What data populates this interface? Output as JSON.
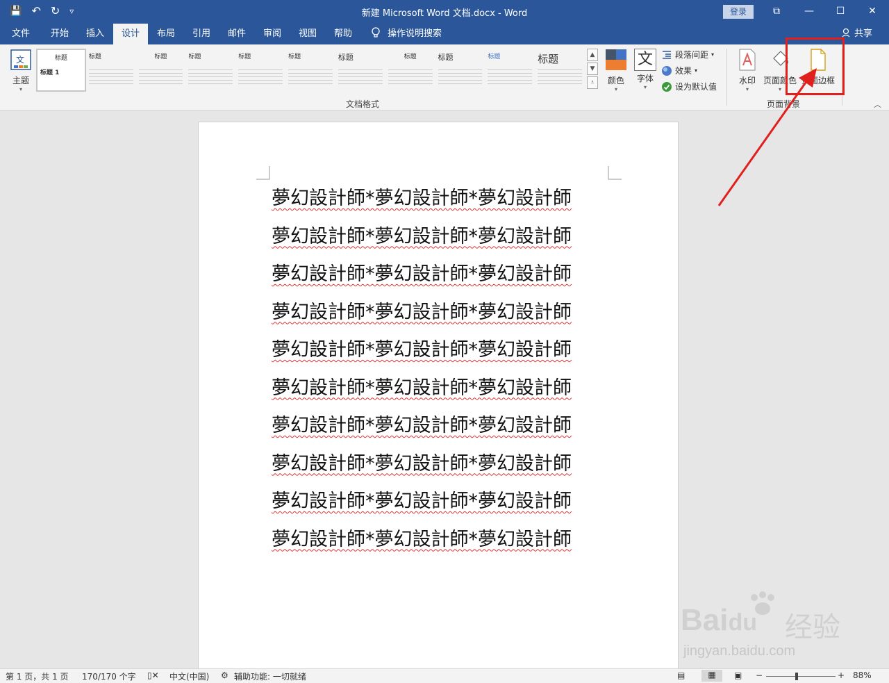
{
  "window": {
    "title": "新建 Microsoft Word 文档.docx  -  Word",
    "login_label": "登录",
    "controls": {
      "ribbon_display": "⧉",
      "minimize": "—",
      "maximize": "☐",
      "close": "✕"
    }
  },
  "qat": {
    "save": "💾",
    "undo": "↶",
    "redo": "↻",
    "more": "▿"
  },
  "tabs": [
    {
      "label": "文件"
    },
    {
      "label": "开始"
    },
    {
      "label": "插入"
    },
    {
      "label": "设计",
      "active": true
    },
    {
      "label": "布局"
    },
    {
      "label": "引用"
    },
    {
      "label": "邮件"
    },
    {
      "label": "审阅"
    },
    {
      "label": "视图"
    },
    {
      "label": "帮助"
    }
  ],
  "search": {
    "label": "操作说明搜索",
    "icon": "lightbulb-icon"
  },
  "share": {
    "label": "共享"
  },
  "ribbon": {
    "theme_label": "主题",
    "gallery_title_first": "标题",
    "gallery_heading_first": "标题 1",
    "gallery_items": [
      "标题",
      "标题",
      "标题",
      "标题",
      "标题",
      "标题",
      "标题",
      "标题",
      "标题",
      "标题"
    ],
    "gallery_last_title": "标题",
    "colors_label": "颜色",
    "fonts_label": "字体",
    "fonts_glyph": "文",
    "paragraph_spacing_label": "段落间距",
    "effects_label": "效果",
    "set_default_label": "设为默认值",
    "doc_format_group": "文档格式",
    "watermark_label": "水印",
    "page_color_label": "页面颜色",
    "page_borders_label": "页面边框",
    "page_background_group": "页面背景"
  },
  "document": {
    "lines": [
      "夢幻設計師*夢幻設計師*夢幻設計師",
      "夢幻設計師*夢幻設計師*夢幻設計師",
      "夢幻設計師*夢幻設計師*夢幻設計師",
      "夢幻設計師*夢幻設計師*夢幻設計師",
      "夢幻設計師*夢幻設計師*夢幻設計師",
      "夢幻設計師*夢幻設計師*夢幻設計師",
      "夢幻設計師*夢幻設計師*夢幻設計師",
      "夢幻設計師*夢幻設計師*夢幻設計師",
      "夢幻設計師*夢幻設計師*夢幻設計師",
      "夢幻設計師*夢幻設計師*夢幻設計師"
    ]
  },
  "watermark": {
    "brand": "Bai",
    "brand_suffix": "du",
    "brand_cn": "经验",
    "url": "jingyan.baidu.com"
  },
  "status": {
    "page": "第 1 页，共 1 页",
    "words": "170/170 个字",
    "language": "中文(中国)",
    "accessibility": "辅助功能: 一切就绪",
    "zoom_minus": "−",
    "zoom_plus": "+",
    "zoom": "88%"
  },
  "colors": {
    "accent": "#2b579a",
    "highlight": "#e0201c"
  }
}
